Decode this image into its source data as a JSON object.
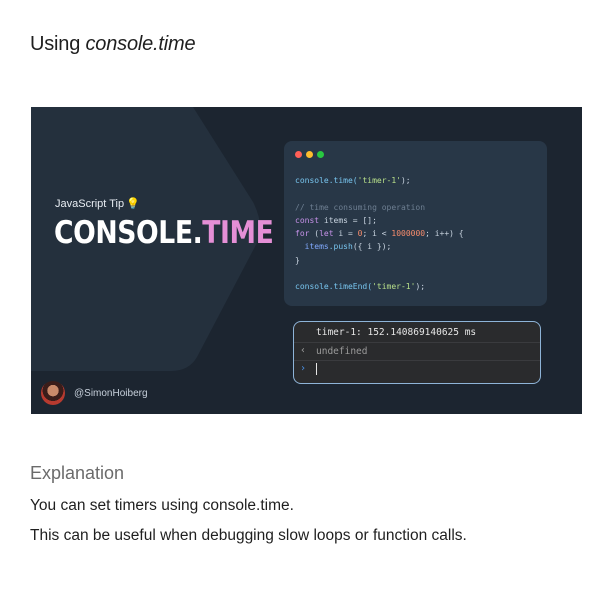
{
  "heading": {
    "prefix": "Using ",
    "emphasis": "console.time"
  },
  "banner": {
    "tip_label": "JavaScript Tip",
    "title_part1": "CONSOLE.",
    "title_part2": "TIME",
    "handle": "@SimonHoiberg",
    "colors": {
      "background": "#1c2530",
      "accent": "#e58fd6",
      "panel": "#283747"
    }
  },
  "code": {
    "l1_obj": "console",
    "l1_fn": ".time(",
    "l1_str": "'timer-1'",
    "l1_end": ");",
    "l2_comment": "// time consuming operation",
    "l3_kw": "const",
    "l3_rest": " items = [];",
    "l4_kw": "for",
    "l4_a": " (",
    "l4_let": "let",
    "l4_b": " i = ",
    "l4_n1": "0",
    "l4_c": "; i < ",
    "l4_n2": "1000000",
    "l4_d": "; i++) {",
    "l5_indent": "  ",
    "l5_var": "items",
    "l5_fn": ".push",
    "l5_rest": "({ i });",
    "l6": "}",
    "l7_obj": "console",
    "l7_fn": ".timeEnd(",
    "l7_str": "'timer-1'",
    "l7_end": ");"
  },
  "console": {
    "output": "timer-1: 152.140869140625 ms",
    "return_value": "undefined"
  },
  "explanation": {
    "heading": "Explanation",
    "line1": "You can set timers using console.time.",
    "line2": "This can be useful when debugging slow loops or function calls."
  }
}
